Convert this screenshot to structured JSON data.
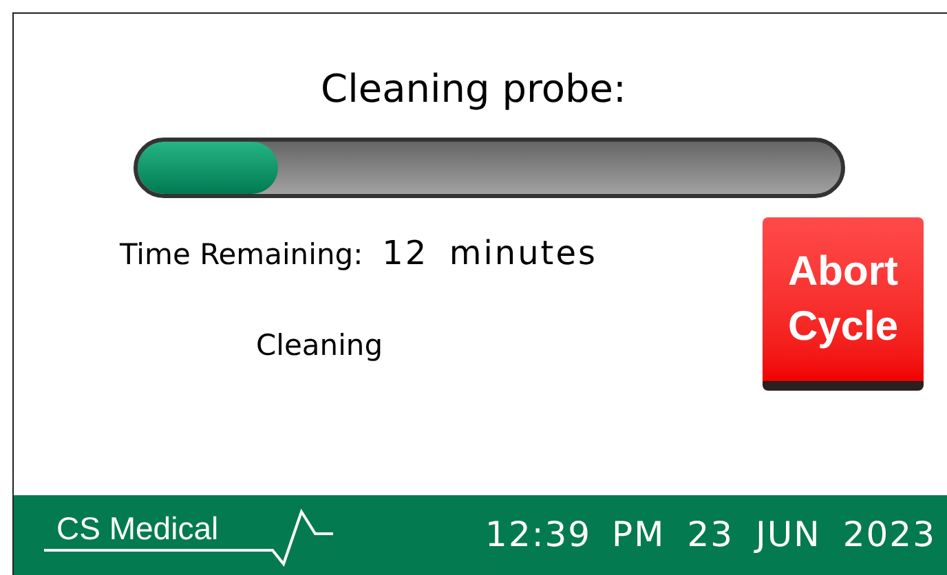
{
  "title": "Cleaning probe:",
  "progress": {
    "level": 0.2
  },
  "time_remaining": {
    "label": "Time Remaining:",
    "value": "12 minutes"
  },
  "status": "Cleaning",
  "abort_button": {
    "line1": "Abort",
    "line2": "Cycle"
  },
  "footer": {
    "logo": "CS Medical",
    "clock": [
      "12:39 PM",
      "23",
      "JUN",
      "2023"
    ]
  }
}
